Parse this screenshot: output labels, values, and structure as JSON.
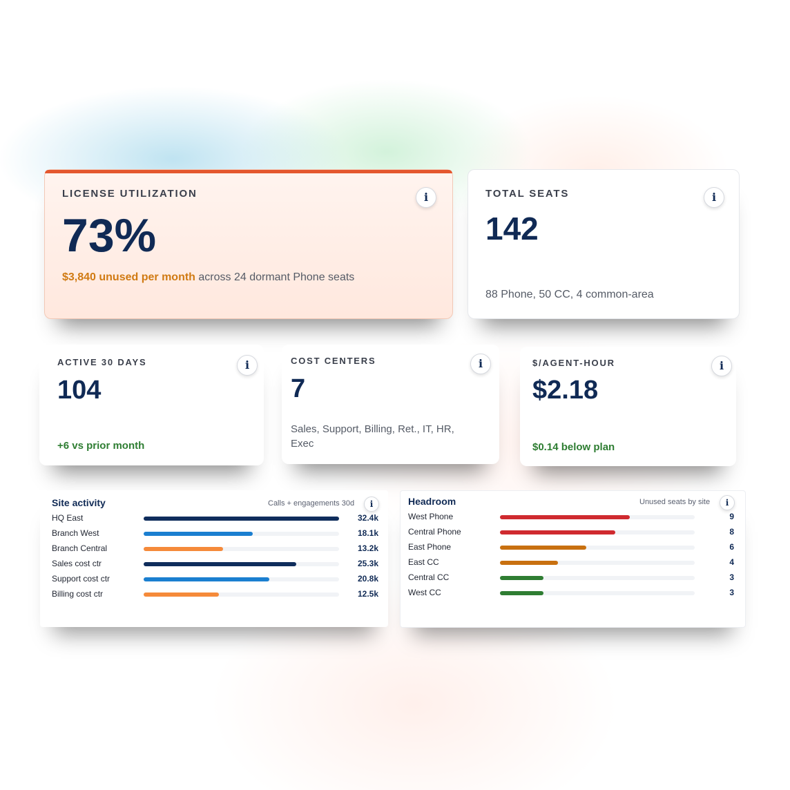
{
  "colors": {
    "navy": "#0f2d5c",
    "blue": "#1b7fd0",
    "orange": "#f58a3a",
    "red": "#cf2a2f",
    "amber": "#c87010",
    "green": "#2f7d32",
    "accent": "#e4572e"
  },
  "license": {
    "label": "LICENSE UTILIZATION",
    "value": "73%",
    "highlight": "$3,840 unused per month",
    "rest": " across 24 dormant Phone seats",
    "info_icon": "info-icon"
  },
  "total_seats": {
    "label": "TOTAL SEATS",
    "value": "142",
    "sub": "88 Phone, 50 CC, 4 common-area"
  },
  "active": {
    "label": "ACTIVE 30 DAYS",
    "value": "104",
    "sub": "+6 vs prior month"
  },
  "cost_centers": {
    "label": "COST CENTERS",
    "value": "7",
    "sub": "Sales, Support, Billing, Ret., IT, HR, Exec"
  },
  "agent_hour": {
    "label": "$/AGENT-HOUR",
    "value": "$2.18",
    "sub": "$0.14 below plan"
  },
  "site_activity": {
    "title": "Site activity",
    "subtitle": "Calls + engagements 30d",
    "max": 32.4,
    "rows": [
      {
        "name": "HQ East",
        "value": 32.4,
        "label": "32.4k",
        "color": "navy"
      },
      {
        "name": "Branch West",
        "value": 18.1,
        "label": "18.1k",
        "color": "blue"
      },
      {
        "name": "Branch Central",
        "value": 13.2,
        "label": "13.2k",
        "color": "orange"
      },
      {
        "name": "Sales cost ctr",
        "value": 25.3,
        "label": "25.3k",
        "color": "navy"
      },
      {
        "name": "Support cost ctr",
        "value": 20.8,
        "label": "20.8k",
        "color": "blue"
      },
      {
        "name": "Billing cost ctr",
        "value": 12.5,
        "label": "12.5k",
        "color": "orange"
      }
    ]
  },
  "headroom": {
    "title": "Headroom",
    "subtitle": "Unused seats by site",
    "max": 13.5,
    "rows": [
      {
        "name": "West Phone",
        "value": 9,
        "label": "9",
        "color": "red"
      },
      {
        "name": "Central Phone",
        "value": 8,
        "label": "8",
        "color": "red"
      },
      {
        "name": "East Phone",
        "value": 6,
        "label": "6",
        "color": "amber"
      },
      {
        "name": "East CC",
        "value": 4,
        "label": "4",
        "color": "amber"
      },
      {
        "name": "Central CC",
        "value": 3,
        "label": "3",
        "color": "green"
      },
      {
        "name": "West CC",
        "value": 3,
        "label": "3",
        "color": "green"
      }
    ]
  }
}
